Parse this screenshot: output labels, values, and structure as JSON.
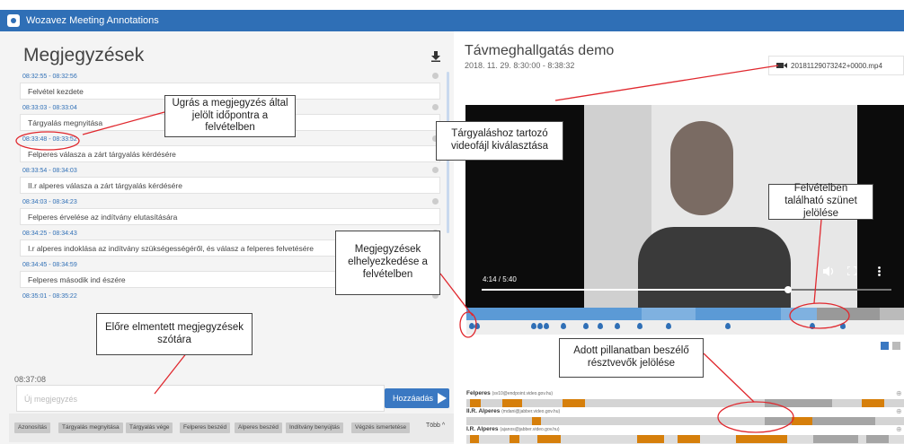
{
  "app": {
    "title": "Wozavez Meeting Annotations"
  },
  "left": {
    "title": "Megjegyzések",
    "download_icon": "download-icon",
    "notes": [
      {
        "time": "08:32:55 - 08:32:56",
        "text": "Felvétel kezdete"
      },
      {
        "time": "08:33:03 - 08:33:04",
        "text": "Tárgyalás megnyitása"
      },
      {
        "time": "08:33:48 - 08:33:52",
        "text": "Felperes válasza a zárt tárgyalás kérdésére"
      },
      {
        "time": "08:33:54 - 08:34:03",
        "text": "II.r alperes válasza a zárt tárgyalás kérdésére"
      },
      {
        "time": "08:34:03 - 08:34:23",
        "text": "Felperes érvelése az indítvány elutasítására"
      },
      {
        "time": "08:34:25 - 08:34:43",
        "text": "I.r alperes indoklása az indítvány szükségességéről, és válasz a felperes felvetésére"
      },
      {
        "time": "08:34:45 - 08:34:59",
        "text": "Felperes második ind                                         észére"
      },
      {
        "time": "08:35:01 - 08:35:22",
        "text": ""
      }
    ],
    "current_time": "08:37:08",
    "new_note_placeholder": "Új megjegyzés",
    "add_button": "Hozzáadás",
    "chips": [
      "Azonosítás",
      "Tárgyalás megnyitása",
      "Tárgyalás vége",
      "Felperes beszéd",
      "Alperes beszéd",
      "Indítvány benyújtás",
      "Végzés ismertetése"
    ],
    "more": "Több ^"
  },
  "right": {
    "title": "Távmeghallgatás demo",
    "subtitle": "2018. 11. 29. 8:30:00 - 8:38:32",
    "file": "20181129073242+0000.mp4",
    "video_time": "4:14 / 5:40",
    "video_progress": 0.747,
    "speakers": [
      {
        "name": "Felperes",
        "detail": "(sv10@endpoint.video.gov.hu)"
      },
      {
        "name": "II.R. Alperes",
        "detail": "(mdani@jabber.video.gov.hu)"
      },
      {
        "name": "I.R. Alperes",
        "detail": "(ajanos@jabber.video.gov.hu)"
      }
    ]
  },
  "annotations": [
    "Ugrás a megjegyzés által jelölt időpontra a felvételben",
    "Tárgyaláshoz tartozó videofájl kiválasztása",
    "Felvételben található szünet jelölése",
    "Megjegyzések elhelyezkedése a felvételben",
    "Előre elmentett megjegyzések szótára",
    "Adott pillanatban beszélő résztvevők jelölése"
  ],
  "colors": {
    "accent": "#2f6fb6",
    "speech": "#d67f0b",
    "annotation": "#e0282e"
  }
}
